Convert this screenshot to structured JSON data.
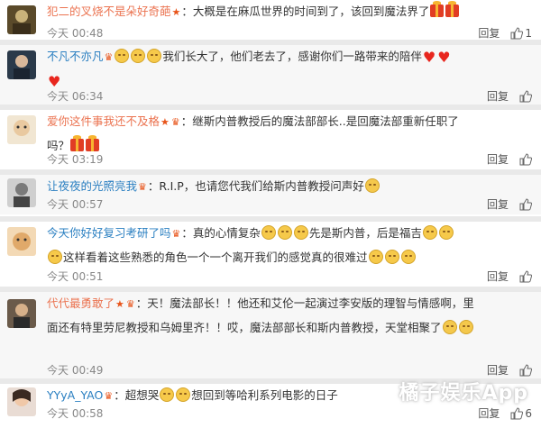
{
  "comments": [
    {
      "username": "犯二的叉烧不是朵好奇葩",
      "text": "：大概是在麻瓜世界的时间到了，该回到魔法界了",
      "text2": "",
      "time": "今天 00:48",
      "reply": "回复",
      "likes": "1"
    },
    {
      "username": "不凡不亦凡",
      "text": "我们长大了，他们老去了，感谢你们一路带来的陪伴",
      "text2": "",
      "time": "今天 06:34",
      "reply": "回复",
      "likes": ""
    },
    {
      "username": "爱你这件事我还不及格",
      "text": "：继斯内普教授后的魔法部部长..是回魔法部重新任职了",
      "text2": "吗？",
      "time": "今天 03:19",
      "reply": "回复",
      "likes": ""
    },
    {
      "username": "让夜夜的光照亮我",
      "text": "：R.I.P，也请您代我们给斯内普教授问声好",
      "text2": "",
      "time": "今天 00:57",
      "reply": "回复",
      "likes": ""
    },
    {
      "username": "今天你好好复习考研了吗",
      "text": "：真的心情复杂",
      "text_mid": "先是斯内普，后是福吉",
      "text2": "这样看着这些熟悉的角色一个一个离开我们的感觉真的很难过",
      "time": "今天 00:51",
      "reply": "回复",
      "likes": ""
    },
    {
      "username": "代代最勇敢了",
      "text": "：天！魔法部长！！他还和艾伦一起演过李安版的理智与情感啊，里",
      "text2": "面还有特里劳尼教授和乌姆里齐！！哎，魔法部部长和斯内普教授，天堂相聚了",
      "time": "今天 00:49",
      "reply": "回复",
      "likes": ""
    },
    {
      "username": "YYyA_YAO",
      "text": "：超想哭",
      "text_mid": "想回到等哈利系列电影的日子",
      "text2": "",
      "time": "今天 00:58",
      "reply": "回复",
      "likes": "6"
    }
  ],
  "watermark": "橘子娱乐App",
  "colors": {
    "username_orange": "#eb7350",
    "username_blue": "#2a7fc1",
    "time": "#888888"
  }
}
